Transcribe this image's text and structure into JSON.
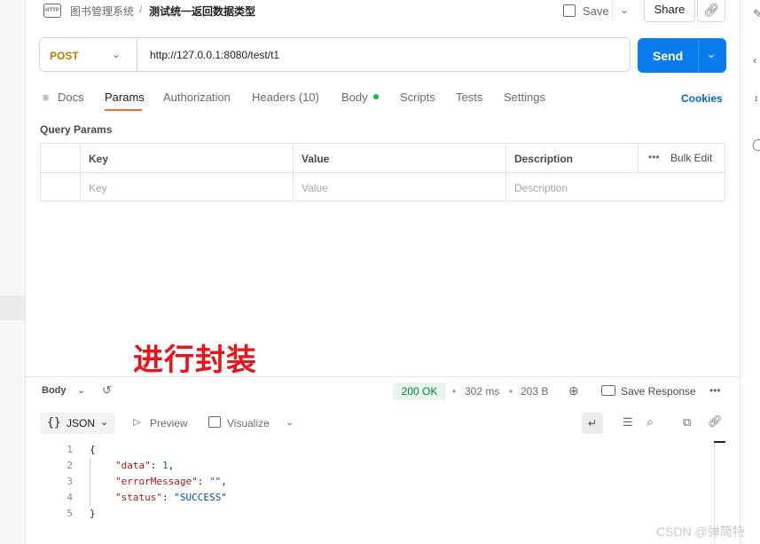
{
  "header": {
    "breadcrumb_collection": "图书管理系统",
    "breadcrumb_sep": "/",
    "request_name": "测试统一返回数据类型",
    "save_label": "Save",
    "share_label": "Share"
  },
  "request": {
    "method": "POST",
    "url": "http://127.0.0.1:8080/test/t1",
    "send_label": "Send"
  },
  "tabs": {
    "docs": "Docs",
    "params": "Params",
    "authorization": "Authorization",
    "headers": "Headers (10)",
    "body": "Body",
    "scripts": "Scripts",
    "tests": "Tests",
    "settings": "Settings",
    "cookies": "Cookies"
  },
  "query_params": {
    "title": "Query Params",
    "columns": [
      "Key",
      "Value",
      "Description"
    ],
    "bulk_edit": "Bulk Edit",
    "placeholders": [
      "Key",
      "Value",
      "Description"
    ]
  },
  "annotation": "进行封装",
  "response": {
    "body_label": "Body",
    "status": "200 OK",
    "time": "302 ms",
    "size": "203 B",
    "save_response": "Save Response",
    "format": "JSON",
    "preview": "Preview",
    "visualize": "Visualize",
    "lines": [
      {
        "n": "1",
        "text": "{"
      },
      {
        "n": "2",
        "key": "\"data\"",
        "sep": ": ",
        "value": "1",
        "end": ","
      },
      {
        "n": "3",
        "key": "\"errorMessage\"",
        "sep": ": ",
        "value": "\"\"",
        "end": ","
      },
      {
        "n": "4",
        "key": "\"status\"",
        "sep": ": ",
        "value": "\"SUCCESS\"",
        "end": ""
      },
      {
        "n": "5",
        "text": "}"
      }
    ]
  },
  "watermark": "CSDN @弹简特",
  "colors": {
    "accent": "#097bed",
    "method": "#b07d00",
    "tab_underline": "#f26b3a",
    "status_ok": "#0d7a39",
    "annotation": "#e8141c"
  }
}
